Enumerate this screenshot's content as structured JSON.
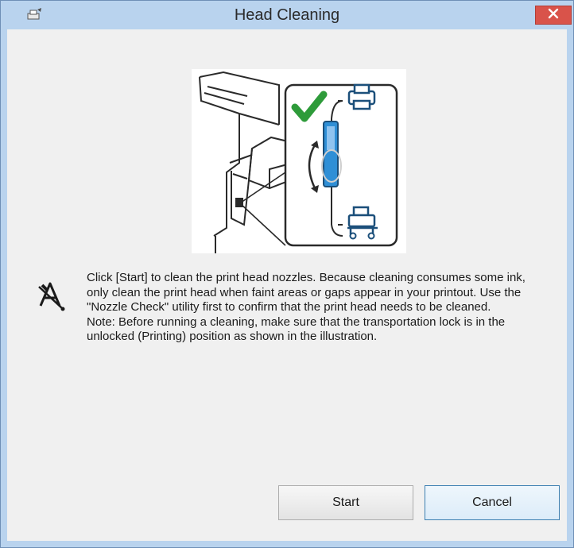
{
  "window": {
    "title": "Head Cleaning",
    "title_icon": "printer-settings-icon",
    "close_icon": "close-icon"
  },
  "illustration": {
    "description_icons": [
      "check-icon",
      "printer-icon",
      "transport-cart-icon",
      "lock-lever-icon"
    ],
    "accent_color": "#2f8fd6",
    "check_color": "#2e9b3a"
  },
  "message": {
    "icon": "info-icon",
    "paragraph_1": "Click [Start] to clean the print head nozzles. Because cleaning consumes some ink, only clean the print head when faint areas or gaps appear in your printout. Use the \"Nozzle Check\" utility first to confirm that the print head needs to be cleaned.",
    "paragraph_2": "Note: Before running a cleaning, make sure that the transportation lock is in the unlocked (Printing) position as shown in the illustration."
  },
  "buttons": {
    "start_label": "Start",
    "cancel_label": "Cancel"
  },
  "colors": {
    "titlebar": "#b9d3ee",
    "close_button": "#d9534a",
    "client_background": "#f0f0f0"
  }
}
